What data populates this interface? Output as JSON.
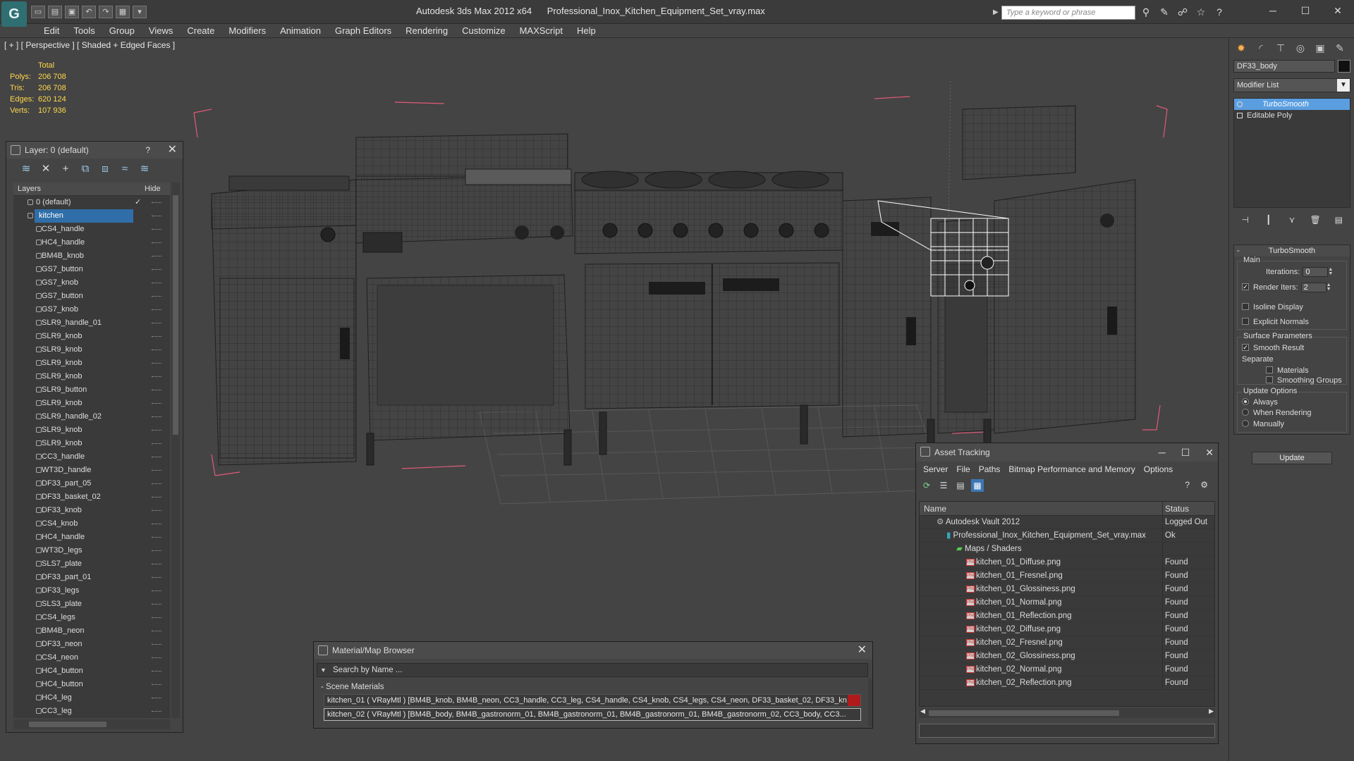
{
  "window": {
    "app_title": "Autodesk 3ds Max  2012 x64",
    "file_title": "Professional_Inox_Kitchen_Equipment_Set_vray.max",
    "search_placeholder": "Type a keyword or phrase"
  },
  "menu": [
    "Edit",
    "Tools",
    "Group",
    "Views",
    "Create",
    "Modifiers",
    "Animation",
    "Graph Editors",
    "Rendering",
    "Customize",
    "MAXScript",
    "Help"
  ],
  "viewport": {
    "label": "[ + ] [ Perspective ] [ Shaded + Edged Faces ]",
    "stats": {
      "header": "Total",
      "rows": [
        {
          "label": "Polys:",
          "value": "206 708"
        },
        {
          "label": "Tris:",
          "value": "206 708"
        },
        {
          "label": "Edges:",
          "value": "620 124"
        },
        {
          "label": "Verts:",
          "value": "107 936"
        }
      ]
    }
  },
  "layer_panel": {
    "title": "Layer: 0 (default)",
    "help": "?",
    "columns": {
      "layers": "Layers",
      "hide": "Hide"
    },
    "top_layers": [
      {
        "name": "0 (default)"
      },
      {
        "name": "kitchen"
      }
    ],
    "objects": [
      "CS4_handle",
      "HC4_handle",
      "BM4B_knob",
      "GS7_button",
      "GS7_knob",
      "GS7_button",
      "GS7_knob",
      "SLR9_handle_01",
      "SLR9_knob",
      "SLR9_knob",
      "SLR9_knob",
      "SLR9_knob",
      "SLR9_button",
      "SLR9_knob",
      "SLR9_handle_02",
      "SLR9_knob",
      "SLR9_knob",
      "CC3_handle",
      "WT3D_handle",
      "DF33_part_05",
      "DF33_basket_02",
      "DF33_knob",
      "CS4_knob",
      "HC4_handle",
      "WT3D_legs",
      "SLS7_plate",
      "DF33_part_01",
      "DF33_legs",
      "SLS3_plate",
      "CS4_legs",
      "BM4B_neon",
      "DF33_neon",
      "CS4_neon",
      "HC4_button",
      "HC4_button",
      "HC4_leg",
      "CC3_leg"
    ]
  },
  "command_panel": {
    "object_name": "DF33_body",
    "modifier_list": "Modifier List",
    "stack": [
      "TurboSmooth",
      "Editable Poly"
    ],
    "turbosmooth": {
      "title": "TurboSmooth",
      "main_group": "Main",
      "iterations_label": "Iterations:",
      "iterations_value": "0",
      "render_iters_label": "Render Iters:",
      "render_iters_value": "2",
      "isoline_display": "Isoline Display",
      "explicit_normals": "Explicit Normals",
      "surface_group": "Surface Parameters",
      "smooth_result": "Smooth Result",
      "separate": "Separate",
      "materials": "Materials",
      "smoothing_groups": "Smoothing Groups",
      "update_group": "Update Options",
      "always": "Always",
      "when_rendering": "When Rendering",
      "manually": "Manually",
      "update_button": "Update"
    }
  },
  "asset_tracking": {
    "title": "Asset Tracking",
    "menu": [
      "Server",
      "File",
      "Paths",
      "Bitmap Performance and Memory",
      "Options"
    ],
    "columns": {
      "name": "Name",
      "status": "Status"
    },
    "rows": [
      {
        "name": "Autodesk Vault 2012",
        "status": "Logged Out",
        "indent": 1,
        "icon": "vault"
      },
      {
        "name": "Professional_Inox_Kitchen_Equipment_Set_vray.max",
        "status": "Ok",
        "indent": 2,
        "icon": "max"
      },
      {
        "name": "Maps / Shaders",
        "status": "",
        "indent": 3,
        "icon": "maps"
      },
      {
        "name": "kitchen_01_Diffuse.png",
        "status": "Found",
        "indent": 4,
        "icon": "png"
      },
      {
        "name": "kitchen_01_Fresnel.png",
        "status": "Found",
        "indent": 4,
        "icon": "png"
      },
      {
        "name": "kitchen_01_Glossiness.png",
        "status": "Found",
        "indent": 4,
        "icon": "png"
      },
      {
        "name": "kitchen_01_Normal.png",
        "status": "Found",
        "indent": 4,
        "icon": "png"
      },
      {
        "name": "kitchen_01_Reflection.png",
        "status": "Found",
        "indent": 4,
        "icon": "png"
      },
      {
        "name": "kitchen_02_Diffuse.png",
        "status": "Found",
        "indent": 4,
        "icon": "png"
      },
      {
        "name": "kitchen_02_Fresnel.png",
        "status": "Found",
        "indent": 4,
        "icon": "png"
      },
      {
        "name": "kitchen_02_Glossiness.png",
        "status": "Found",
        "indent": 4,
        "icon": "png"
      },
      {
        "name": "kitchen_02_Normal.png",
        "status": "Found",
        "indent": 4,
        "icon": "png"
      },
      {
        "name": "kitchen_02_Reflection.png",
        "status": "Found",
        "indent": 4,
        "icon": "png"
      }
    ]
  },
  "material_browser": {
    "title": "Material/Map Browser",
    "search_placeholder": "Search by Name ...",
    "group": "- Scene Materials",
    "materials": [
      "kitchen_01  ( VRayMtl ) [BM4B_knob, BM4B_neon, CC3_handle, CC3_leg, CS4_handle, CS4_knob, CS4_legs, CS4_neon, DF33_basket_02, DF33_kn...",
      "kitchen_02  ( VRayMtl ) [BM4B_body, BM4B_gastronorm_01, BM4B_gastronorm_01, BM4B_gastronorm_01, BM4B_gastronorm_02, CC3_body, CC3..."
    ]
  },
  "colors": {
    "accent": "#2f6ea8",
    "selection": "#5b9ee0",
    "stats_text": "#ffd84b",
    "wire_selected": "#ffffff",
    "bounding_box": "#e05a7a"
  }
}
